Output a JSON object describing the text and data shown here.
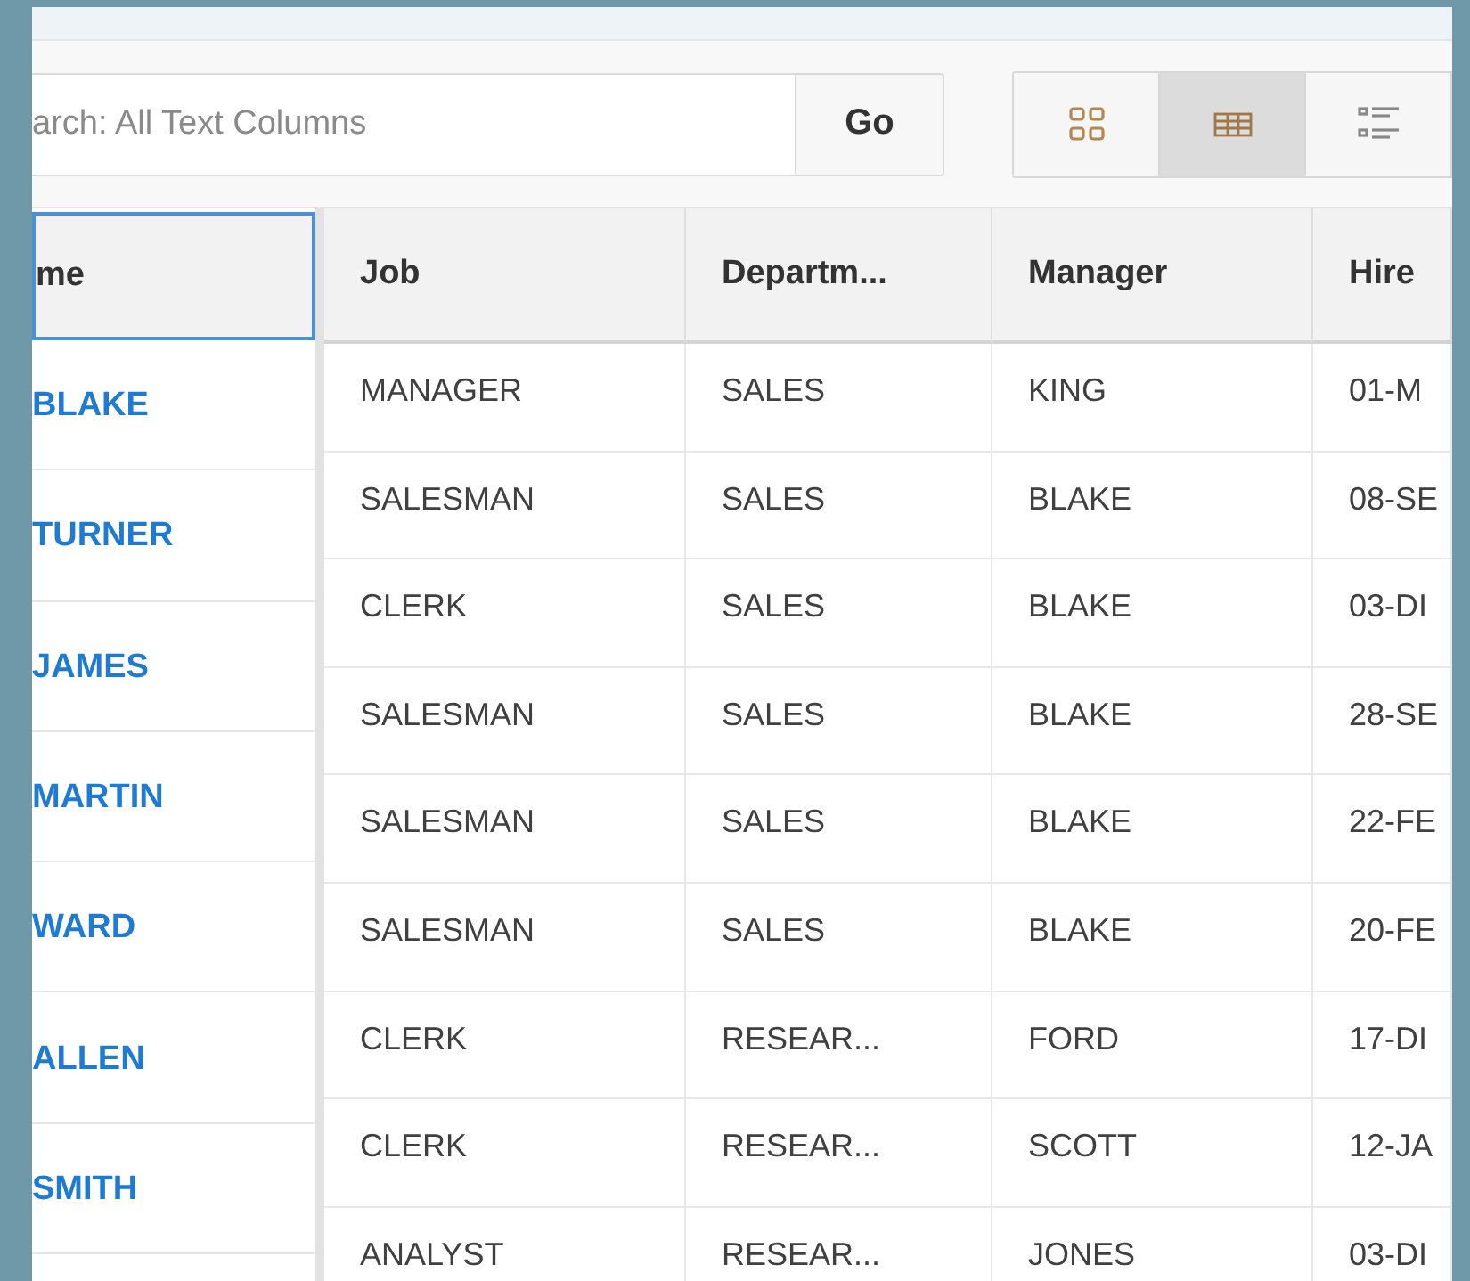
{
  "toolbar": {
    "search": {
      "placeholder": "arch: All Text Columns"
    },
    "go_button": "Go",
    "view_buttons": [
      {
        "kind": "icons",
        "selected": false
      },
      {
        "kind": "report",
        "selected": true
      },
      {
        "kind": "detail",
        "selected": false
      }
    ]
  },
  "table": {
    "frozen_column": {
      "label": "me",
      "selected": true
    },
    "columns": [
      {
        "label": "Job",
        "selected": false
      },
      {
        "label": "Departm...",
        "selected": false
      },
      {
        "label": "Manager",
        "selected": false
      },
      {
        "label": "Hire",
        "selected": false
      }
    ],
    "names": [
      "BLAKE",
      "TURNER",
      "JAMES",
      "MARTIN",
      "WARD",
      "ALLEN",
      "SMITH"
    ],
    "rows": [
      [
        "MANAGER",
        "SALES",
        "KING",
        "01-M"
      ],
      [
        "SALESMAN",
        "SALES",
        "BLAKE",
        "08-SE"
      ],
      [
        "CLERK",
        "SALES",
        "BLAKE",
        "03-DI"
      ],
      [
        "SALESMAN",
        "SALES",
        "BLAKE",
        "28-SE"
      ],
      [
        "SALESMAN",
        "SALES",
        "BLAKE",
        "22-FE"
      ],
      [
        "SALESMAN",
        "SALES",
        "BLAKE",
        "20-FE"
      ],
      [
        "CLERK",
        "RESEAR...",
        "FORD",
        "17-DI"
      ],
      [
        "CLERK",
        "RESEAR...",
        "SCOTT",
        "12-JA"
      ],
      [
        "ANALYST",
        "RESEAR...",
        "JONES",
        "03-DI"
      ]
    ]
  }
}
